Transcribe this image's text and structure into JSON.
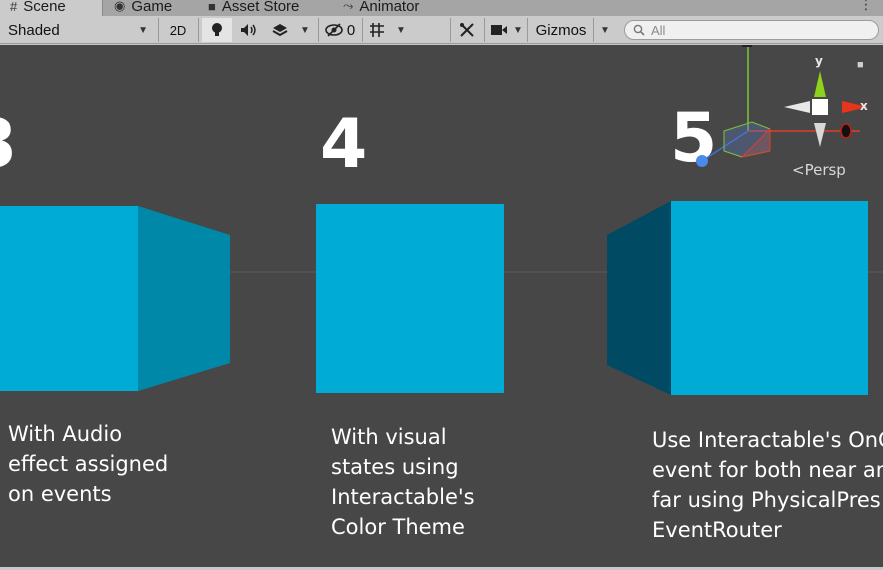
{
  "tabs": [
    {
      "label": "Scene",
      "icon": "#"
    },
    {
      "label": "Game",
      "icon": "gamepad-icon"
    },
    {
      "label": "Asset Store",
      "icon": "bag-icon"
    },
    {
      "label": "Animator",
      "icon": "animator-icon"
    }
  ],
  "toolbar": {
    "draw_mode": "Shaded",
    "mode_2d": "2D",
    "hidden_count": "0",
    "gizmos": "Gizmos",
    "search_placeholder": "All"
  },
  "scene": {
    "numbers": [
      "3",
      "4",
      "5"
    ],
    "captions": [
      [
        "With Audio",
        "effect assigned",
        "on events"
      ],
      [
        "With visual",
        "states using",
        "Interactable's",
        "Color Theme"
      ],
      [
        "Use Interactable's OnC",
        "event for both near an",
        "far using PhysicalPres",
        "EventRouter"
      ]
    ],
    "persp_label": "Persp",
    "axis_x": "x",
    "axis_y": "y"
  },
  "colors": {
    "cube_front": "#00acd6",
    "cube_side_right": "#0088a9",
    "cube_side_left": "#004a63",
    "scene_bg": "#474747"
  }
}
